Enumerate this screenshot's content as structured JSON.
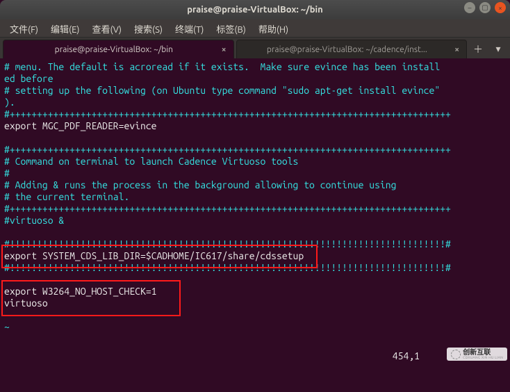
{
  "window": {
    "title": "praise@praise-VirtualBox: ~/bin"
  },
  "menu": {
    "file": "文件(F)",
    "edit": "编辑(E)",
    "view": "查看(V)",
    "search": "搜索(S)",
    "terminal": "终端(T)",
    "tabs": "标签(B)",
    "help": "帮助(H)"
  },
  "tabs": [
    {
      "label": "praise@praise-VirtualBox: ~/bin"
    },
    {
      "label": "praise@praise-VirtualBox: ~/cadence/inst..."
    }
  ],
  "terminal": {
    "lines": [
      {
        "cls": "cyan",
        "text": "# menu. The default is acroread if it exists.  Make sure evince has been install"
      },
      {
        "cls": "cyan",
        "text": "ed before"
      },
      {
        "cls": "cyan",
        "text": "# setting up the following (on Ubuntu type command \"sudo apt-get install evince\""
      },
      {
        "cls": "cyan",
        "text": ")."
      },
      {
        "cls": "cyan",
        "text": "#+++++++++++++++++++++++++++++++++++++++++++++++++++++++++++++++++++++++++++++++++"
      },
      {
        "cls": "white",
        "text": "export MGC_PDF_READER=evince"
      },
      {
        "cls": "white",
        "text": ""
      },
      {
        "cls": "cyan",
        "text": "#+++++++++++++++++++++++++++++++++++++++++++++++++++++++++++++++++++++++++++++++++"
      },
      {
        "cls": "cyan",
        "text": "# Command on terminal to launch Cadence Virtuoso tools"
      },
      {
        "cls": "cyan",
        "text": "#"
      },
      {
        "cls": "cyan",
        "text": "# Adding & runs the process in the background allowing to continue using"
      },
      {
        "cls": "cyan",
        "text": "# the current terminal."
      },
      {
        "cls": "cyan",
        "text": "#+++++++++++++++++++++++++++++++++++++++++++++++++++++++++++++++++++++++++++++++++"
      },
      {
        "cls": "cyan",
        "text": "#virtuoso &"
      },
      {
        "cls": "white",
        "text": ""
      },
      {
        "cls": "cyan",
        "text": "#!!!!!!!!!!!!!!!!!!!!!!!!!!!!!!!!!!!!!!!!!!!!!!!!!!!!!!!!!!!!!!!!!!!!!!!!!!!!!!!!#"
      },
      {
        "cls": "white",
        "text": "export SYSTEM_CDS_LIB_DIR=$CADHOME/IC617/share/cdssetup"
      },
      {
        "cls": "cyan",
        "text": "#!!!!!!!!!!!!!!!!!!!!!!!!!!!!!!!!!!!!!!!!!!!!!!!!!!!!!!!!!!!!!!!!!!!!!!!!!!!!!!!!#"
      },
      {
        "cls": "white",
        "text": ""
      },
      {
        "cls": "white",
        "text": "export W3264_NO_HOST_CHECK=1"
      },
      {
        "cls": "white",
        "text": "virtuoso"
      },
      {
        "cls": "cyan",
        "text": "~"
      },
      {
        "cls": "cyan",
        "text": "~"
      }
    ],
    "status": "454,1"
  },
  "watermark": {
    "brand": "创新互联",
    "sub": "CDXUANG XIN HU LIAN"
  }
}
